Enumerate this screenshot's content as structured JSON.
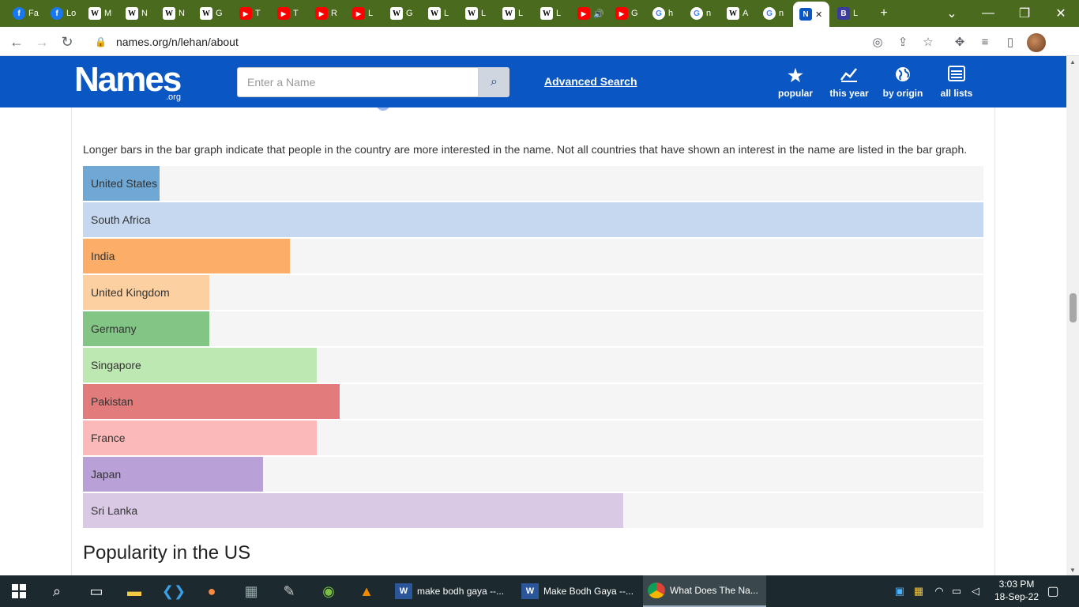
{
  "browser": {
    "tabs": [
      {
        "title": "Fa",
        "icon": "facebook-icon",
        "type": "fb",
        "glyph": "f"
      },
      {
        "title": "Lo",
        "icon": "facebook-icon",
        "type": "fb",
        "glyph": "f"
      },
      {
        "title": "M",
        "icon": "wikipedia-icon",
        "type": "w",
        "glyph": "W"
      },
      {
        "title": "N",
        "icon": "wikipedia-icon",
        "type": "w",
        "glyph": "W"
      },
      {
        "title": "N",
        "icon": "wikipedia-icon",
        "type": "w",
        "glyph": "W"
      },
      {
        "title": "G",
        "icon": "wikipedia-icon",
        "type": "w",
        "glyph": "W"
      },
      {
        "title": "T",
        "icon": "youtube-icon",
        "type": "yt",
        "glyph": "▶"
      },
      {
        "title": "T",
        "icon": "youtube-icon",
        "type": "yt",
        "glyph": "▶"
      },
      {
        "title": "R",
        "icon": "youtube-icon",
        "type": "yt",
        "glyph": "▶"
      },
      {
        "title": "L",
        "icon": "youtube-icon",
        "type": "yt",
        "glyph": "▶"
      },
      {
        "title": "G",
        "icon": "wikipedia-icon",
        "type": "w",
        "glyph": "W"
      },
      {
        "title": "L",
        "icon": "wikipedia-icon",
        "type": "w",
        "glyph": "W"
      },
      {
        "title": "L",
        "icon": "wikipedia-icon",
        "type": "w",
        "glyph": "W"
      },
      {
        "title": "L",
        "icon": "wikipedia-icon",
        "type": "w",
        "glyph": "W"
      },
      {
        "title": "L",
        "icon": "wikipedia-icon",
        "type": "w",
        "glyph": "W"
      },
      {
        "title": "🔊",
        "icon": "youtube-icon",
        "type": "yt",
        "glyph": "▶"
      },
      {
        "title": "G",
        "icon": "youtube-icon",
        "type": "yt",
        "glyph": "▶"
      },
      {
        "title": "h",
        "icon": "google-icon",
        "type": "g",
        "glyph": "G"
      },
      {
        "title": "n",
        "icon": "google-icon",
        "type": "g",
        "glyph": "G"
      },
      {
        "title": "A",
        "icon": "wikipedia-icon",
        "type": "w",
        "glyph": "W"
      },
      {
        "title": "n",
        "icon": "google-icon",
        "type": "g",
        "glyph": "G"
      },
      {
        "title": "✕",
        "icon": "names-org-icon",
        "type": "n",
        "glyph": "N",
        "active": true
      },
      {
        "title": "L",
        "icon": "bing-icon",
        "type": "b",
        "glyph": "B"
      }
    ],
    "url": "names.org/n/lehan/about",
    "new_tab": "+",
    "tab_search": "⌄",
    "minimize": "—",
    "restore": "❐",
    "close": "✕"
  },
  "site": {
    "logo_text": "Names",
    "logo_sub": ".org",
    "search_placeholder": "Enter a Name",
    "advanced_search": "Advanced Search",
    "nav": [
      {
        "label": "popular",
        "icon": "star-icon",
        "glyph": "★"
      },
      {
        "label": "this year",
        "icon": "trend-chart-icon",
        "glyph": "📈"
      },
      {
        "label": "by origin",
        "icon": "globe-icon",
        "glyph": "🌍"
      },
      {
        "label": "all lists",
        "icon": "list-icon",
        "glyph": "☰"
      }
    ]
  },
  "main": {
    "description": "Longer bars in the bar graph indicate that people in the country are more interested in the name. Not all countries that have shown an interest in the name are listed in the bar graph.",
    "section_title": "Popularity in the US"
  },
  "chart_data": {
    "type": "bar",
    "orientation": "horizontal",
    "categories": [
      "United States",
      "South Africa",
      "India",
      "United Kingdom",
      "Germany",
      "Singapore",
      "Pakistan",
      "France",
      "Japan",
      "Sri Lanka"
    ],
    "values": [
      8.5,
      100,
      23,
      14,
      14,
      26,
      28.5,
      26,
      20,
      60
    ],
    "colors": [
      "#6fa8d4",
      "#c6d8f0",
      "#fcad67",
      "#fdd0a2",
      "#82c584",
      "#bde8b1",
      "#e27b7b",
      "#fbb9ba",
      "#b9a0d6",
      "#dac9e5"
    ],
    "xlim": [
      0,
      100
    ],
    "grid": false,
    "legend": "none"
  },
  "taskbar": {
    "tasks": [
      {
        "label": "make bodh gaya --...",
        "icon": "word-icon"
      },
      {
        "label": "Make Bodh Gaya --...",
        "icon": "word-icon"
      },
      {
        "label": "What Does The Na...",
        "icon": "chrome-icon",
        "active": true
      }
    ],
    "time": "3:03 PM",
    "date": "18-Sep-22"
  }
}
